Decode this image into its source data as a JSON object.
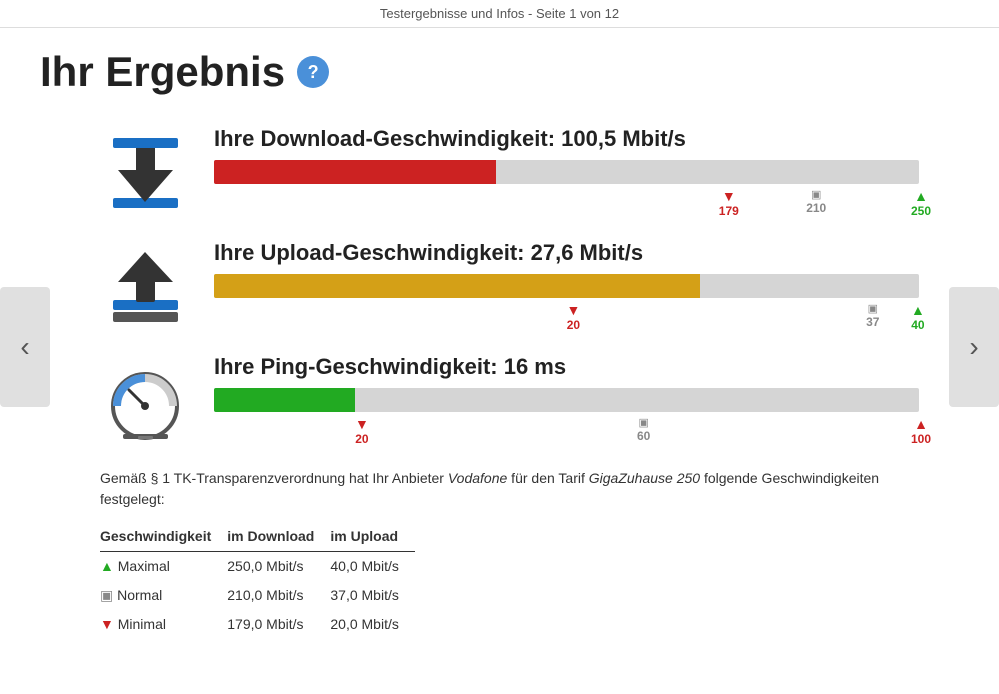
{
  "header": {
    "text": "Testergebnisse und Infos - Seite 1 von 12"
  },
  "page": {
    "title": "Ihr Ergebnis",
    "help_icon": "?"
  },
  "nav": {
    "left": "‹",
    "right": "›"
  },
  "download": {
    "label": "Ihre Download-Geschwindigkeit:",
    "value": "100,5 Mbit/s",
    "bar_pct": 40,
    "markers": {
      "min": {
        "value": "179",
        "pct": 71.6
      },
      "normal": {
        "value": "210",
        "pct": 84
      },
      "max": {
        "value": "250",
        "pct": 100
      }
    }
  },
  "upload": {
    "label": "Ihre Upload-Geschwindigkeit:",
    "value": "27,6 Mbit/s",
    "bar_pct": 69,
    "markers": {
      "min": {
        "value": "20",
        "pct": 50
      },
      "normal": {
        "value": "37",
        "pct": 92.5
      },
      "max": {
        "value": "40",
        "pct": 100
      }
    }
  },
  "ping": {
    "label": "Ihre Ping-Geschwindigkeit:",
    "value": "16 ms",
    "bar_pct": 20,
    "markers": {
      "min": {
        "value": "20",
        "pct": 20
      },
      "normal": {
        "value": "60",
        "pct": 60
      },
      "max": {
        "value": "100",
        "pct": 100
      }
    }
  },
  "info": {
    "text_prefix": "Gemäß § 1 TK-Transparenzverordnung hat Ihr Anbieter ",
    "provider": "Vodafone",
    "text_middle": " für den Tarif ",
    "tarif": "GigaZuhause 250",
    "text_suffix": " folgende Geschwindigkeiten festgelegt:",
    "table": {
      "headers": [
        "Geschwindigkeit",
        "im Download",
        "im Upload"
      ],
      "rows": [
        {
          "type": "max",
          "label": "Maximal",
          "download": "250,0 Mbit/s",
          "upload": "40,0 Mbit/s"
        },
        {
          "type": "normal",
          "label": "Normal",
          "download": "210,0 Mbit/s",
          "upload": "37,0 Mbit/s"
        },
        {
          "type": "min",
          "label": "Minimal",
          "download": "179,0 Mbit/s",
          "upload": "20,0 Mbit/s"
        }
      ]
    }
  }
}
